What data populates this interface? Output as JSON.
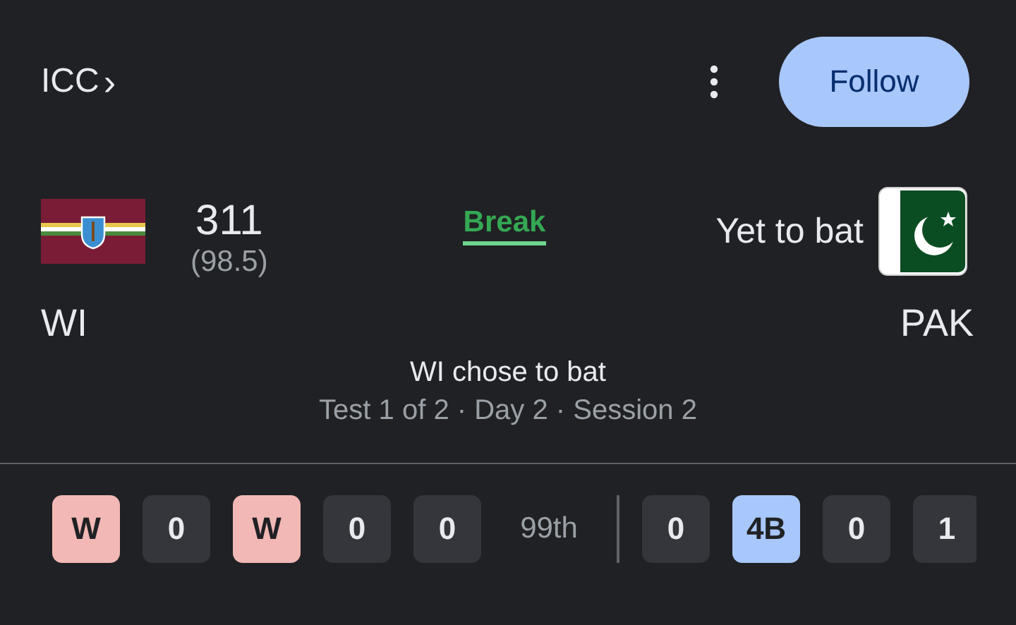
{
  "header": {
    "competition": "ICC",
    "chevron": "›",
    "follow_button": "Follow"
  },
  "match": {
    "team1": {
      "name": "WI",
      "score": "311",
      "overs": "(98.5)"
    },
    "status": "Break",
    "team2": {
      "name": "PAK",
      "status": "Yet to bat"
    },
    "summary": "WI chose to bat",
    "details": "Test 1 of 2 · Day 2 · Session 2"
  },
  "balls": [
    {
      "kind": "wicket",
      "text": "W"
    },
    {
      "kind": "dot",
      "text": "0"
    },
    {
      "kind": "wicket",
      "text": "W"
    },
    {
      "kind": "dot",
      "text": "0"
    },
    {
      "kind": "dot",
      "text": "0"
    },
    {
      "kind": "over",
      "text": "99th"
    },
    {
      "kind": "divider"
    },
    {
      "kind": "dot",
      "text": "0"
    },
    {
      "kind": "boundary",
      "text": "4B"
    },
    {
      "kind": "dot",
      "text": "0"
    },
    {
      "kind": "dot",
      "text": "1"
    }
  ]
}
